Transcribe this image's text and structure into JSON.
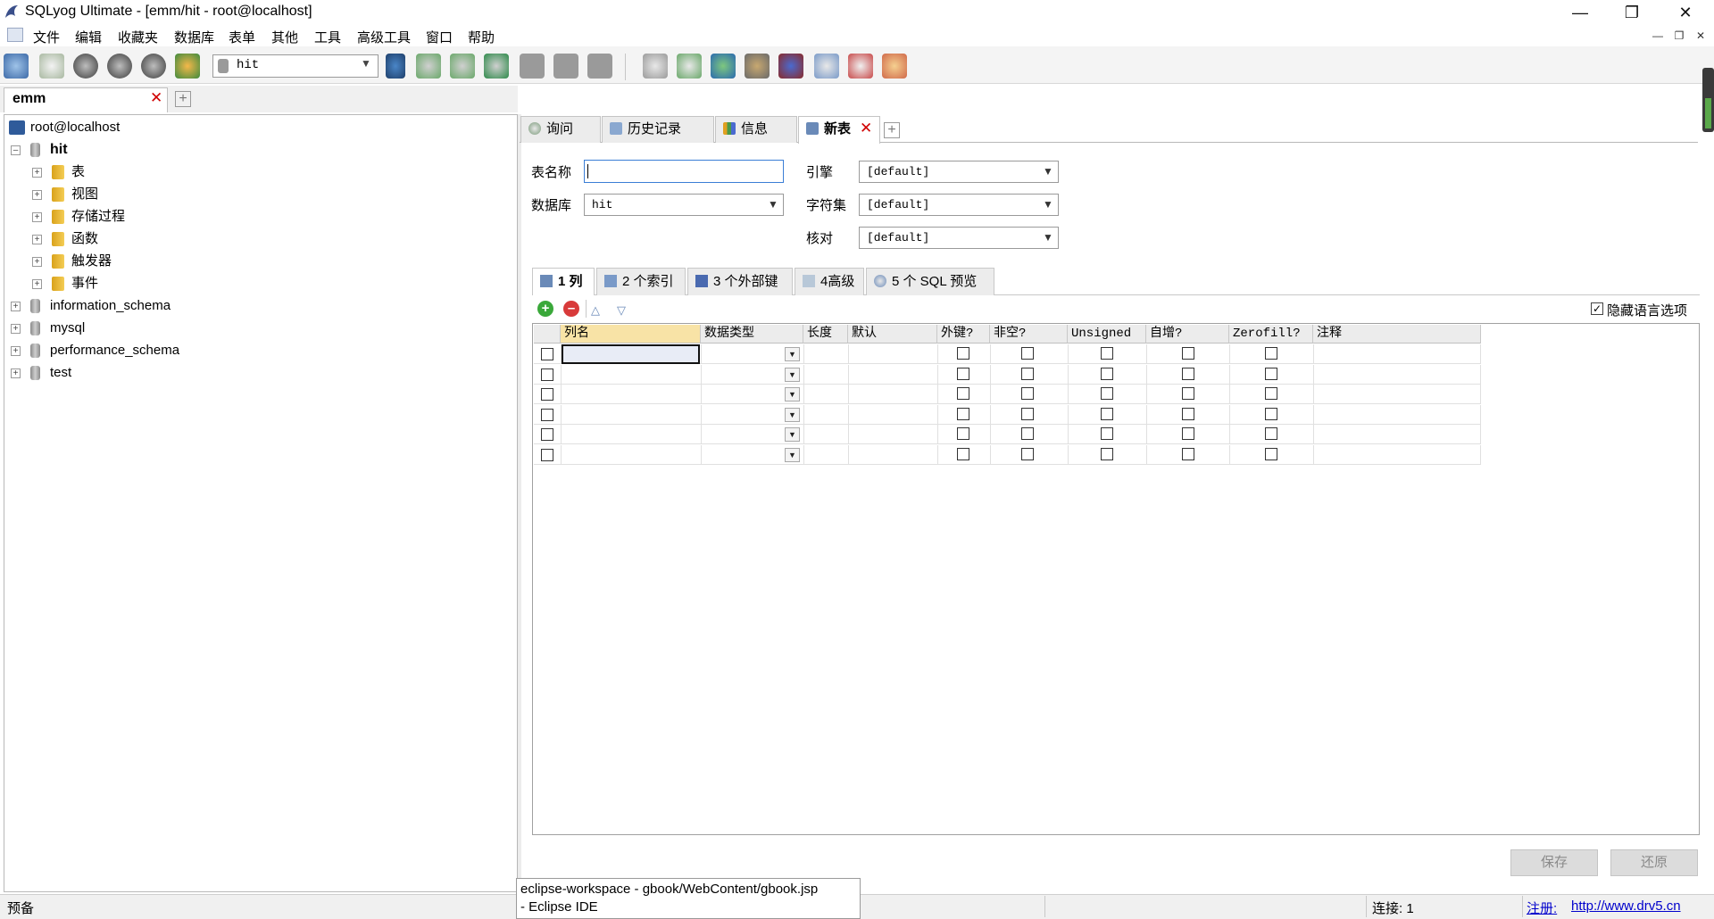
{
  "window": {
    "title": "SQLyog Ultimate - [emm/hit - root@localhost]"
  },
  "menu": [
    "文件",
    "编辑",
    "收藏夹",
    "数据库",
    "表单",
    "其他",
    "工具",
    "高级工具",
    "窗口",
    "帮助"
  ],
  "toolbar": {
    "database_select": "hit"
  },
  "connection_tab": {
    "label": "emm"
  },
  "tree": {
    "server": "root@localhost",
    "active_db": "hit",
    "hit_children": [
      "表",
      "视图",
      "存储过程",
      "函数",
      "触发器",
      "事件"
    ],
    "other_dbs": [
      "information_schema",
      "mysql",
      "performance_schema",
      "test"
    ]
  },
  "query_tabs": [
    "询问",
    "历史记录",
    "信息",
    "新表"
  ],
  "form": {
    "table_name_label": "表名称",
    "table_name_value": "",
    "database_label": "数据库",
    "database_value": "hit",
    "engine_label": "引擎",
    "engine_value": "[default]",
    "charset_label": "字符集",
    "charset_value": "[default]",
    "collation_label": "核对",
    "collation_value": "[default]"
  },
  "sub_tabs": [
    "1 列",
    "2 个索引",
    "3 个外部键",
    "4高级",
    "5 个 SQL 预览"
  ],
  "hide_language_options": {
    "label": "隐藏语言选项",
    "checked": true
  },
  "grid": {
    "columns": [
      "列名",
      "数据类型",
      "长度",
      "默认",
      "外键?",
      "非空?",
      "Unsigned",
      "自增?",
      "Zerofill?",
      "注释"
    ],
    "row_count": 6
  },
  "buttons": {
    "save": "保存",
    "revert": "还原"
  },
  "status": {
    "left": "预备",
    "connection": "连接: 1",
    "register_label": "注册:",
    "register_url": "http://www.drv5.cn"
  },
  "tooltip": {
    "line1": "eclipse-workspace - gbook/WebContent/gbook.jsp",
    "line2": "- Eclipse IDE"
  }
}
